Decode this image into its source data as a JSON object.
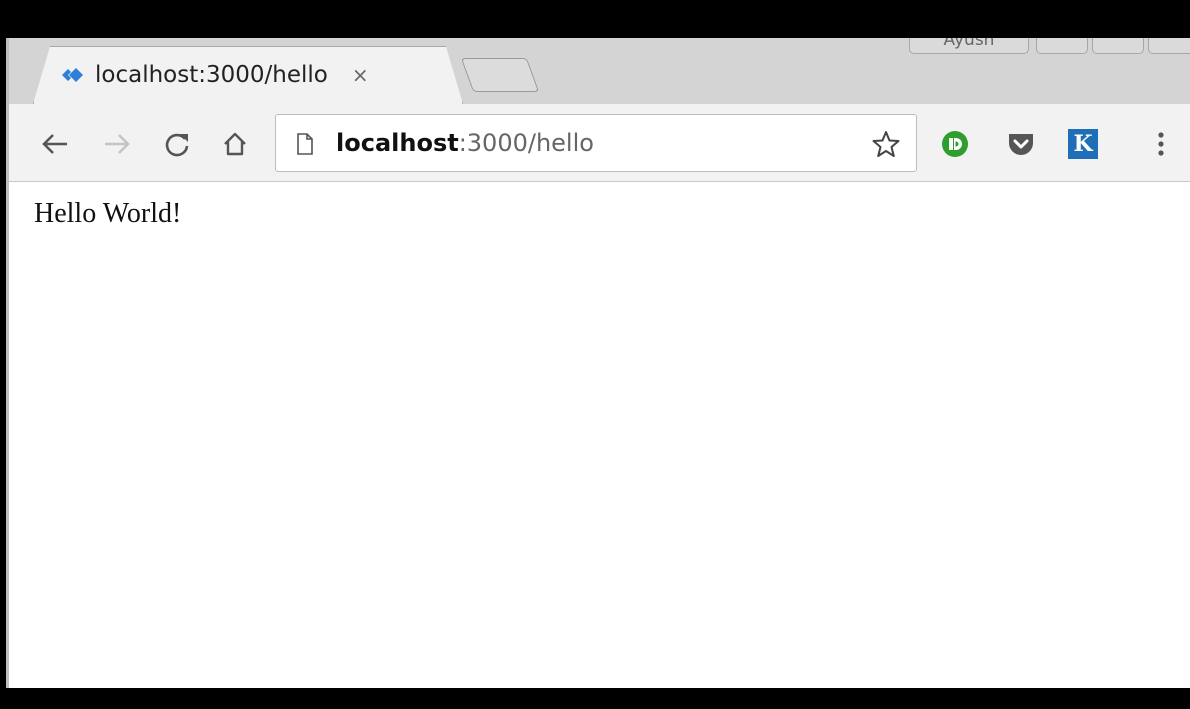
{
  "browser": {
    "profile_name": "Ayush",
    "tab": {
      "title": "localhost:3000/hello",
      "close_glyph": "×"
    },
    "address_bar": {
      "host": "localhost",
      "rest": ":3000/hello"
    },
    "extensions": {
      "k_label": "K"
    },
    "colors": {
      "favicon": "#2f7fd6",
      "ghostery": "#2e9e2e",
      "pocket": "#555555",
      "k_extension": "#1e6fb8"
    }
  },
  "page": {
    "body_text": "Hello World!"
  }
}
